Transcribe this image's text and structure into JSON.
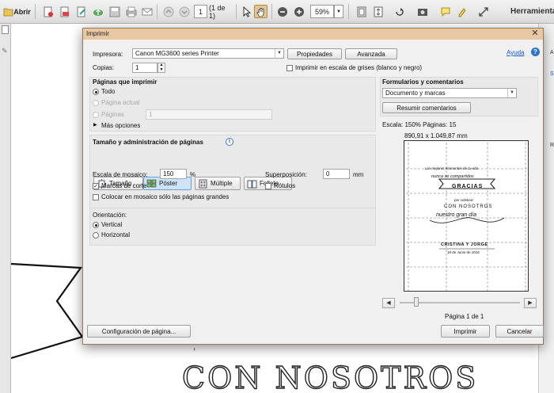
{
  "toolbar": {
    "open_label": "Abrir",
    "page_number": "1",
    "page_count": "(1 de 1)",
    "zoom": "59%",
    "tools_label": "Herramienta"
  },
  "document": {
    "big_text": "CON NOSOTROS"
  },
  "dialog": {
    "title": "Imprimir",
    "help_link": "Ayuda",
    "printer_label": "Impresora:",
    "printer_value": "Canon MG3600 series Printer",
    "properties_button": "Propiedades",
    "advanced_button": "Avanzada",
    "copies_label": "Copias:",
    "copies_value": "1",
    "grayscale_label": "Imprimir en escala de grises (blanco y negro)",
    "pages": {
      "heading": "Páginas que imprimir",
      "all": "Todo",
      "current": "Página actual",
      "pages_label": "Páginas",
      "pages_value": "1",
      "more_options": "Más opciones"
    },
    "sizing": {
      "heading": "Tamaño y administración de páginas",
      "modes": [
        "Tamaño",
        "Póster",
        "Múltiple",
        "Folleto"
      ],
      "tile_scale_label": "Escala de mosaico:",
      "tile_scale_value": "150",
      "tile_scale_unit": "%",
      "overlap_label": "Superposición:",
      "overlap_value": "0",
      "overlap_unit": "mm",
      "cut_marks": "Marcas de corte",
      "labels": "Rótulos",
      "tile_large_only": "Colocar en mosaico sólo las páginas grandes"
    },
    "orientation": {
      "heading": "Orientación:",
      "portrait": "Vertical",
      "landscape": "Horizontal"
    },
    "forms": {
      "heading": "Formularios y comentarios",
      "select_value": "Documento y marcas",
      "summarize_button": "Resumir comentarios"
    },
    "preview": {
      "scale_text": "Escala: 150% Páginas: 15",
      "dimensions": "890,91 x 1.049,87 mm",
      "page_text": "Página 1 de 1",
      "line1": "Los mejores momentos de la vida",
      "line2": "nunca se compartidos",
      "line3": "GRACIAS",
      "line4": "por celebrar",
      "line5": "CON NOSOTROS",
      "line6": "nuestro gran día",
      "line7": "CRISTINA Y JORGE",
      "line8": "18 de Junio de 2016"
    },
    "page_setup_button": "Configuración de página...",
    "print_button": "Imprimir",
    "cancel_button": "Cancelar"
  },
  "colors": {
    "title_bar": "#e7c8a3",
    "active_mode": "#cfe3f6",
    "help_link": "#1a57c9"
  }
}
